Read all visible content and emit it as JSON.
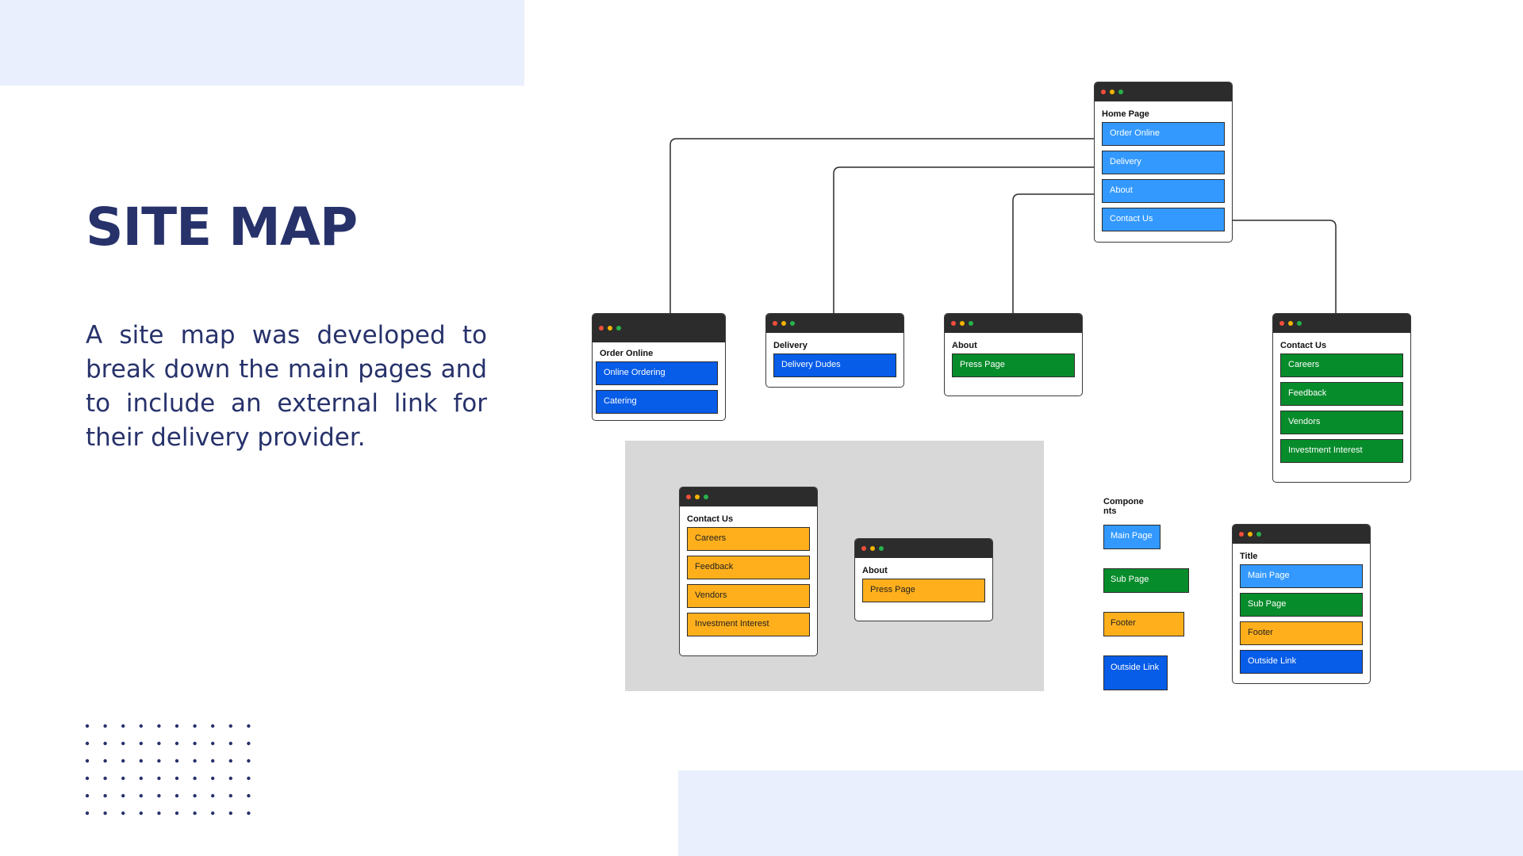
{
  "slide": {
    "title": "SITE MAP",
    "description": "A site map was developed to break down the main pages and to include an external link for their delivery provider."
  },
  "home": {
    "title": "Home Page",
    "items": [
      "Order Online",
      "Delivery",
      "About",
      "Contact Us"
    ]
  },
  "order_online": {
    "title": "Order Online",
    "items": [
      "Online Ordering",
      "Catering"
    ]
  },
  "delivery": {
    "title": "Delivery",
    "items": [
      "Delivery Dudes"
    ]
  },
  "about": {
    "title": "About",
    "items": [
      "Press Page"
    ]
  },
  "contact": {
    "title": "Contact Us",
    "items": [
      "Careers",
      "Feedback",
      "Vendors",
      "Investment Interest"
    ]
  },
  "alt_contact": {
    "title": "Contact Us",
    "items": [
      "Careers",
      "Feedback",
      "Vendors",
      "Investment Interest"
    ]
  },
  "alt_about": {
    "title": "About",
    "items": [
      "Press Page"
    ]
  },
  "components": {
    "label": "Compone nts",
    "main": "Main Page",
    "sub": "Sub Page",
    "footer": "Footer",
    "outside": "Outside Link"
  },
  "legend_window": {
    "title": "Title",
    "items": [
      "Main Page",
      "Sub Page",
      "Footer",
      "Outside Link"
    ]
  },
  "colors": {
    "main_page": "#3399ff",
    "sub_page": "#078c2b",
    "footer": "#ffaf1c",
    "outside_link": "#075ce8",
    "heading": "#27326b",
    "accent_bg": "#e9effd"
  }
}
